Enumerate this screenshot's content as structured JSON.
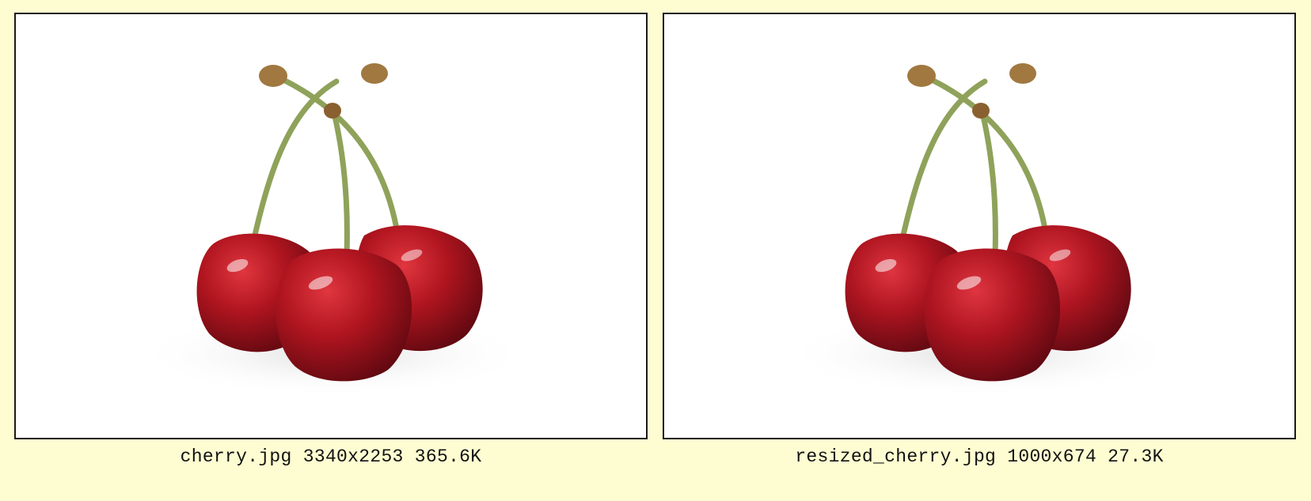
{
  "images": [
    {
      "caption": "cherry.jpg 3340x2253 365.6K",
      "subject": "three-red-cherries-with-stems"
    },
    {
      "caption": "resized_cherry.jpg 1000x674 27.3K",
      "subject": "three-red-cherries-with-stems"
    }
  ],
  "colors": {
    "page_background": "#fefdd2",
    "frame_border": "#1a1a1a",
    "cherry_red": "#a3121c",
    "stem_green": "#8fa25a"
  }
}
